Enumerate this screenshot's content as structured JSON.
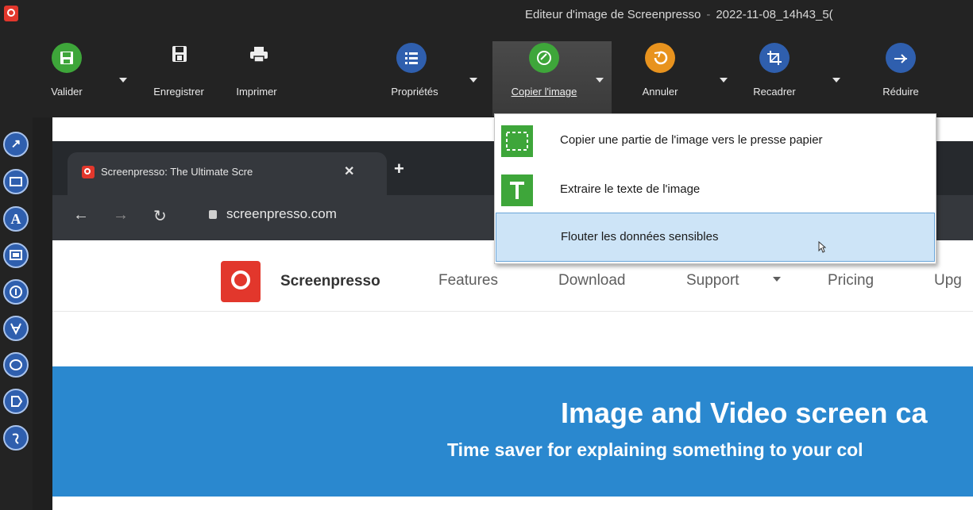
{
  "window": {
    "title": "Editeur d'image de Screenpresso",
    "filename": "2022-11-08_14h43_5("
  },
  "toolbar": {
    "validate_label": "Valider",
    "save_label": "Enregistrer",
    "print_label": "Imprimer",
    "properties_label": "Propriétés",
    "copy_label": "Copier l'image",
    "undo_label": "Annuler",
    "crop_label": "Recadrer",
    "reduce_label": "Réduire"
  },
  "tools": {
    "text_glyph": "A"
  },
  "browser": {
    "tab_title": "Screenpresso: The Ultimate Scre",
    "new_tab": "+",
    "url": "screenpresso.com"
  },
  "site": {
    "brand": "Screenpresso",
    "nav": [
      "Features",
      "Download",
      "Support",
      "Pricing",
      "Upg"
    ],
    "hero_title": "Image and Video screen ca",
    "hero_subtitle": "Time saver for explaining something to your col"
  },
  "menu": {
    "items": [
      {
        "label": "Copier une partie de l'image vers le presse papier",
        "icon": "selection-icon"
      },
      {
        "label": "Extraire le texte de l'image",
        "icon": "text-extract-icon"
      },
      {
        "label": "Flouter les données sensibles",
        "icon": "blur-icon"
      }
    ]
  },
  "colors": {
    "accent_green": "#3ea63a",
    "accent_blue": "#2f5fae",
    "accent_orange": "#e8931e",
    "brand_red": "#e2372c",
    "hero_blue": "#2a88cf",
    "menu_highlight": "#cde4f7"
  }
}
